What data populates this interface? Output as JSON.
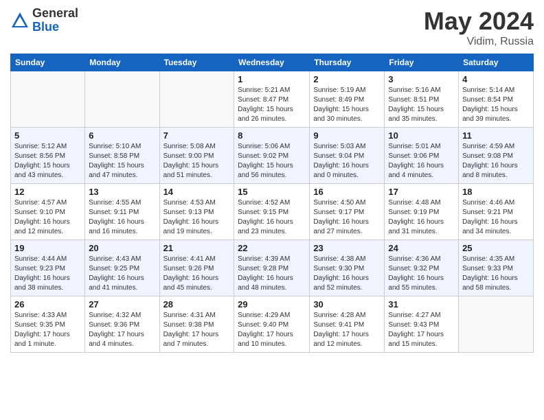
{
  "header": {
    "logo_general": "General",
    "logo_blue": "Blue",
    "month_year": "May 2024",
    "location": "Vidim, Russia"
  },
  "days_of_week": [
    "Sunday",
    "Monday",
    "Tuesday",
    "Wednesday",
    "Thursday",
    "Friday",
    "Saturday"
  ],
  "weeks": [
    [
      {
        "day": "",
        "info": ""
      },
      {
        "day": "",
        "info": ""
      },
      {
        "day": "",
        "info": ""
      },
      {
        "day": "1",
        "info": "Sunrise: 5:21 AM\nSunset: 8:47 PM\nDaylight: 15 hours\nand 26 minutes."
      },
      {
        "day": "2",
        "info": "Sunrise: 5:19 AM\nSunset: 8:49 PM\nDaylight: 15 hours\nand 30 minutes."
      },
      {
        "day": "3",
        "info": "Sunrise: 5:16 AM\nSunset: 8:51 PM\nDaylight: 15 hours\nand 35 minutes."
      },
      {
        "day": "4",
        "info": "Sunrise: 5:14 AM\nSunset: 8:54 PM\nDaylight: 15 hours\nand 39 minutes."
      }
    ],
    [
      {
        "day": "5",
        "info": "Sunrise: 5:12 AM\nSunset: 8:56 PM\nDaylight: 15 hours\nand 43 minutes."
      },
      {
        "day": "6",
        "info": "Sunrise: 5:10 AM\nSunset: 8:58 PM\nDaylight: 15 hours\nand 47 minutes."
      },
      {
        "day": "7",
        "info": "Sunrise: 5:08 AM\nSunset: 9:00 PM\nDaylight: 15 hours\nand 51 minutes."
      },
      {
        "day": "8",
        "info": "Sunrise: 5:06 AM\nSunset: 9:02 PM\nDaylight: 15 hours\nand 56 minutes."
      },
      {
        "day": "9",
        "info": "Sunrise: 5:03 AM\nSunset: 9:04 PM\nDaylight: 16 hours\nand 0 minutes."
      },
      {
        "day": "10",
        "info": "Sunrise: 5:01 AM\nSunset: 9:06 PM\nDaylight: 16 hours\nand 4 minutes."
      },
      {
        "day": "11",
        "info": "Sunrise: 4:59 AM\nSunset: 9:08 PM\nDaylight: 16 hours\nand 8 minutes."
      }
    ],
    [
      {
        "day": "12",
        "info": "Sunrise: 4:57 AM\nSunset: 9:10 PM\nDaylight: 16 hours\nand 12 minutes."
      },
      {
        "day": "13",
        "info": "Sunrise: 4:55 AM\nSunset: 9:11 PM\nDaylight: 16 hours\nand 16 minutes."
      },
      {
        "day": "14",
        "info": "Sunrise: 4:53 AM\nSunset: 9:13 PM\nDaylight: 16 hours\nand 19 minutes."
      },
      {
        "day": "15",
        "info": "Sunrise: 4:52 AM\nSunset: 9:15 PM\nDaylight: 16 hours\nand 23 minutes."
      },
      {
        "day": "16",
        "info": "Sunrise: 4:50 AM\nSunset: 9:17 PM\nDaylight: 16 hours\nand 27 minutes."
      },
      {
        "day": "17",
        "info": "Sunrise: 4:48 AM\nSunset: 9:19 PM\nDaylight: 16 hours\nand 31 minutes."
      },
      {
        "day": "18",
        "info": "Sunrise: 4:46 AM\nSunset: 9:21 PM\nDaylight: 16 hours\nand 34 minutes."
      }
    ],
    [
      {
        "day": "19",
        "info": "Sunrise: 4:44 AM\nSunset: 9:23 PM\nDaylight: 16 hours\nand 38 minutes."
      },
      {
        "day": "20",
        "info": "Sunrise: 4:43 AM\nSunset: 9:25 PM\nDaylight: 16 hours\nand 41 minutes."
      },
      {
        "day": "21",
        "info": "Sunrise: 4:41 AM\nSunset: 9:26 PM\nDaylight: 16 hours\nand 45 minutes."
      },
      {
        "day": "22",
        "info": "Sunrise: 4:39 AM\nSunset: 9:28 PM\nDaylight: 16 hours\nand 48 minutes."
      },
      {
        "day": "23",
        "info": "Sunrise: 4:38 AM\nSunset: 9:30 PM\nDaylight: 16 hours\nand 52 minutes."
      },
      {
        "day": "24",
        "info": "Sunrise: 4:36 AM\nSunset: 9:32 PM\nDaylight: 16 hours\nand 55 minutes."
      },
      {
        "day": "25",
        "info": "Sunrise: 4:35 AM\nSunset: 9:33 PM\nDaylight: 16 hours\nand 58 minutes."
      }
    ],
    [
      {
        "day": "26",
        "info": "Sunrise: 4:33 AM\nSunset: 9:35 PM\nDaylight: 17 hours\nand 1 minute."
      },
      {
        "day": "27",
        "info": "Sunrise: 4:32 AM\nSunset: 9:36 PM\nDaylight: 17 hours\nand 4 minutes."
      },
      {
        "day": "28",
        "info": "Sunrise: 4:31 AM\nSunset: 9:38 PM\nDaylight: 17 hours\nand 7 minutes."
      },
      {
        "day": "29",
        "info": "Sunrise: 4:29 AM\nSunset: 9:40 PM\nDaylight: 17 hours\nand 10 minutes."
      },
      {
        "day": "30",
        "info": "Sunrise: 4:28 AM\nSunset: 9:41 PM\nDaylight: 17 hours\nand 12 minutes."
      },
      {
        "day": "31",
        "info": "Sunrise: 4:27 AM\nSunset: 9:43 PM\nDaylight: 17 hours\nand 15 minutes."
      },
      {
        "day": "",
        "info": ""
      }
    ]
  ]
}
